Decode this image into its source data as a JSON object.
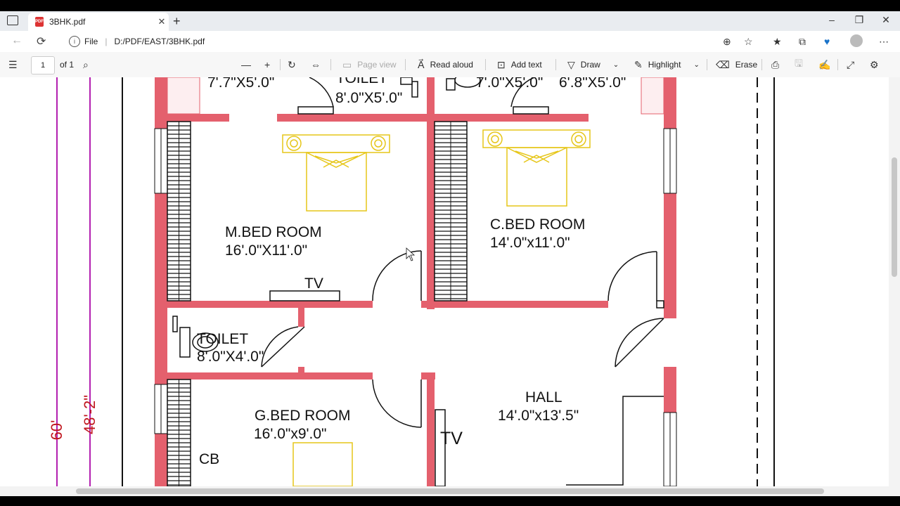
{
  "browser": {
    "tab_title": "3BHK.pdf",
    "pdf_icon_text": "PDF",
    "url_scheme": "File",
    "url_path": "D:/PDF/EAST/3BHK.pdf"
  },
  "pdf_toolbar": {
    "page_number": "1",
    "page_total": "of 1",
    "page_view": "Page view",
    "read_aloud": "Read aloud",
    "add_text": "Add text",
    "draw": "Draw",
    "highlight": "Highlight",
    "erase": "Erase"
  },
  "plan": {
    "top_left_size": "7'.7\"X5'.0\"",
    "top_toilet_label": "TOILET",
    "top_toilet_size": "8'.0\"X5'.0\"",
    "top_mid_size": "7'.0\"X5'.0\"",
    "top_right_size": "6'.8\"X5'.0\"",
    "master_bed_label": "M.BED ROOM",
    "master_bed_size": "16'.0\"X11'.0\"",
    "tv1": "TV",
    "child_bed_label": "C.BED ROOM",
    "child_bed_size": "14'.0\"x11'.0\"",
    "toilet2_label": "TOILET",
    "toilet2_size": "8'.0\"X4'.0\"",
    "guest_bed_label": "G.BED ROOM",
    "guest_bed_size": "16'.0\"x9'.0\"",
    "cb": "CB",
    "hall_label": "HALL",
    "hall_size": "14'.0\"x13'.5\"",
    "tv2": "TV",
    "dim_60": "60'",
    "dim_48": "48'-2\""
  },
  "colors": {
    "wall": "#e4606d",
    "furniture": "#e6c619",
    "dim_line": "#b31fb0",
    "dim_text": "#c0161e"
  }
}
